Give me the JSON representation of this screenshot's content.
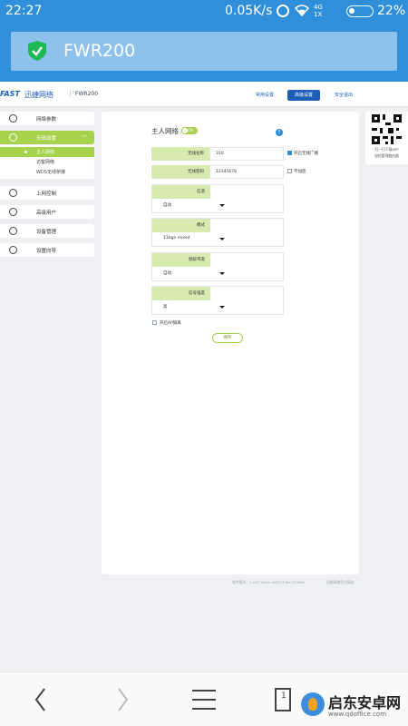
{
  "status": {
    "time": "22:27",
    "speed": "0.05K/s",
    "network": "4G\n1X",
    "battery": "22%",
    "battery_level": 0.22
  },
  "app": {
    "title": "FWR200"
  },
  "router": {
    "logo": "FAST",
    "logo_cn": "迅捷网络",
    "separator": "|",
    "model": "FWR200",
    "nav": [
      "常用设置",
      "高级设置",
      "安全退出"
    ],
    "nav_active": 1
  },
  "sidebar": {
    "items": [
      {
        "label": "网络参数"
      },
      {
        "label": "无线设置"
      },
      {
        "label": "上网控制"
      },
      {
        "label": "高级用户"
      },
      {
        "label": "设备管理"
      },
      {
        "label": "设置向导"
      }
    ],
    "chevron": "﹀",
    "submenu": [
      "主人网络",
      "访客网络",
      "WDS无线桥接"
    ]
  },
  "main": {
    "section_title": "主人网络",
    "toggle": "ON",
    "help": "?",
    "ssid_label": "无线名称",
    "ssid_value": "310",
    "broadcast_label": "开启无线广播",
    "password_label": "无线密码",
    "password_value": "12345678",
    "no_encrypt_label": "不加密",
    "security_label": "信道",
    "security_value": "自动",
    "mode_label": "模式",
    "mode_value": "11bgn mixed",
    "bandwidth_label": "频段带宽",
    "bandwidth_value": "自动",
    "power_label": "信号强度",
    "power_value": "高",
    "ap_isolation_label": "开启AP隔离",
    "save_label": "保存"
  },
  "qr": {
    "text1": "扫一扫下载APP",
    "text2": "轻松管理路由器"
  },
  "footer": {
    "version": "软件版本：1.0.87 Build 160223 Rel.53496n",
    "site": "迅捷网络官方网站"
  },
  "watermark": {
    "name": "启东安卓网",
    "url": "www.qdoffice.com"
  }
}
